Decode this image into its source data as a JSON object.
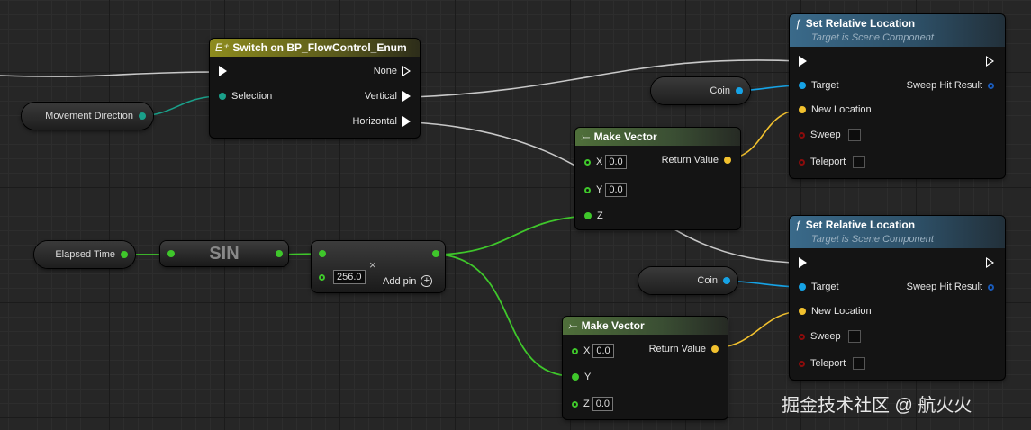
{
  "switch_node": {
    "title": "Switch on BP_FlowControl_Enum",
    "selection": "Selection",
    "outputs": [
      "None",
      "Vertical",
      "Horizontal"
    ]
  },
  "movement_direction": {
    "label": "Movement Direction"
  },
  "elapsed_time": {
    "label": "Elapsed Time"
  },
  "sin_node": {
    "label": "SIN"
  },
  "multiply_node": {
    "value": "256.0",
    "add_pin": "Add pin"
  },
  "make_vector_1": {
    "title": "Make Vector",
    "x_label": "X",
    "x_value": "0.0",
    "y_label": "Y",
    "y_value": "0.0",
    "z_label": "Z",
    "output": "Return Value"
  },
  "make_vector_2": {
    "title": "Make Vector",
    "x_label": "X",
    "x_value": "0.0",
    "y_label": "Y",
    "z_label": "Z",
    "z_value": "0.0",
    "output": "Return Value"
  },
  "set_loc_1": {
    "title": "Set Relative Location",
    "subtitle": "Target is Scene Component",
    "target": "Target",
    "new_location": "New Location",
    "sweep": "Sweep",
    "teleport": "Teleport",
    "sweep_hit": "Sweep Hit Result"
  },
  "set_loc_2": {
    "title": "Set Relative Location",
    "subtitle": "Target is Scene Component",
    "target": "Target",
    "new_location": "New Location",
    "sweep": "Sweep",
    "teleport": "Teleport",
    "sweep_hit": "Sweep Hit Result"
  },
  "coin_1": {
    "label": "Coin"
  },
  "coin_2": {
    "label": "Coin"
  },
  "watermark": "掘金技术社区 @ 航火火",
  "colors": {
    "exec": "#ffffff",
    "enum": "#1aa08a",
    "float": "#3fc72b",
    "vector": "#f2c12e",
    "object": "#16a3e6",
    "bool": "#8b0c0c",
    "struct": "#1a5ab8"
  }
}
